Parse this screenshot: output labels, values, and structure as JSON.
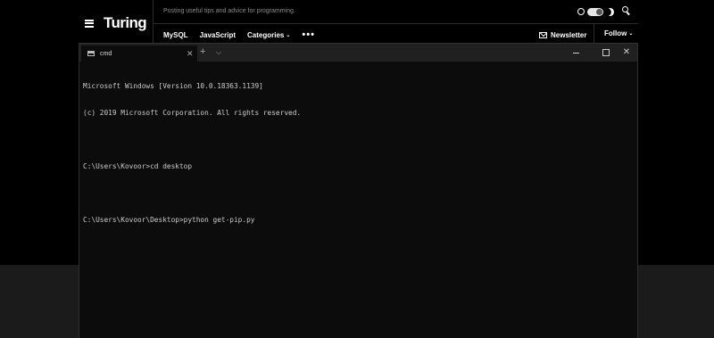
{
  "site": {
    "logo": "Turing",
    "tagline": "Posting useful tips and advice for programming.",
    "nav": [
      {
        "label": "MySQL"
      },
      {
        "label": "JavaScript"
      },
      {
        "label": "Categories"
      }
    ],
    "more": "•••",
    "newsletter": "Newsletter",
    "follow": "Follow"
  },
  "terminal": {
    "tab_title": "cmd",
    "lines": [
      "Microsoft Windows [Version 10.0.18363.1139]",
      "(c) 2019 Microsoft Corporation. All rights reserved.",
      "",
      "C:\\Users\\Kovoor>cd desktop",
      "",
      "C:\\Users\\Kovoor\\Desktop>python get-pip.py"
    ]
  }
}
